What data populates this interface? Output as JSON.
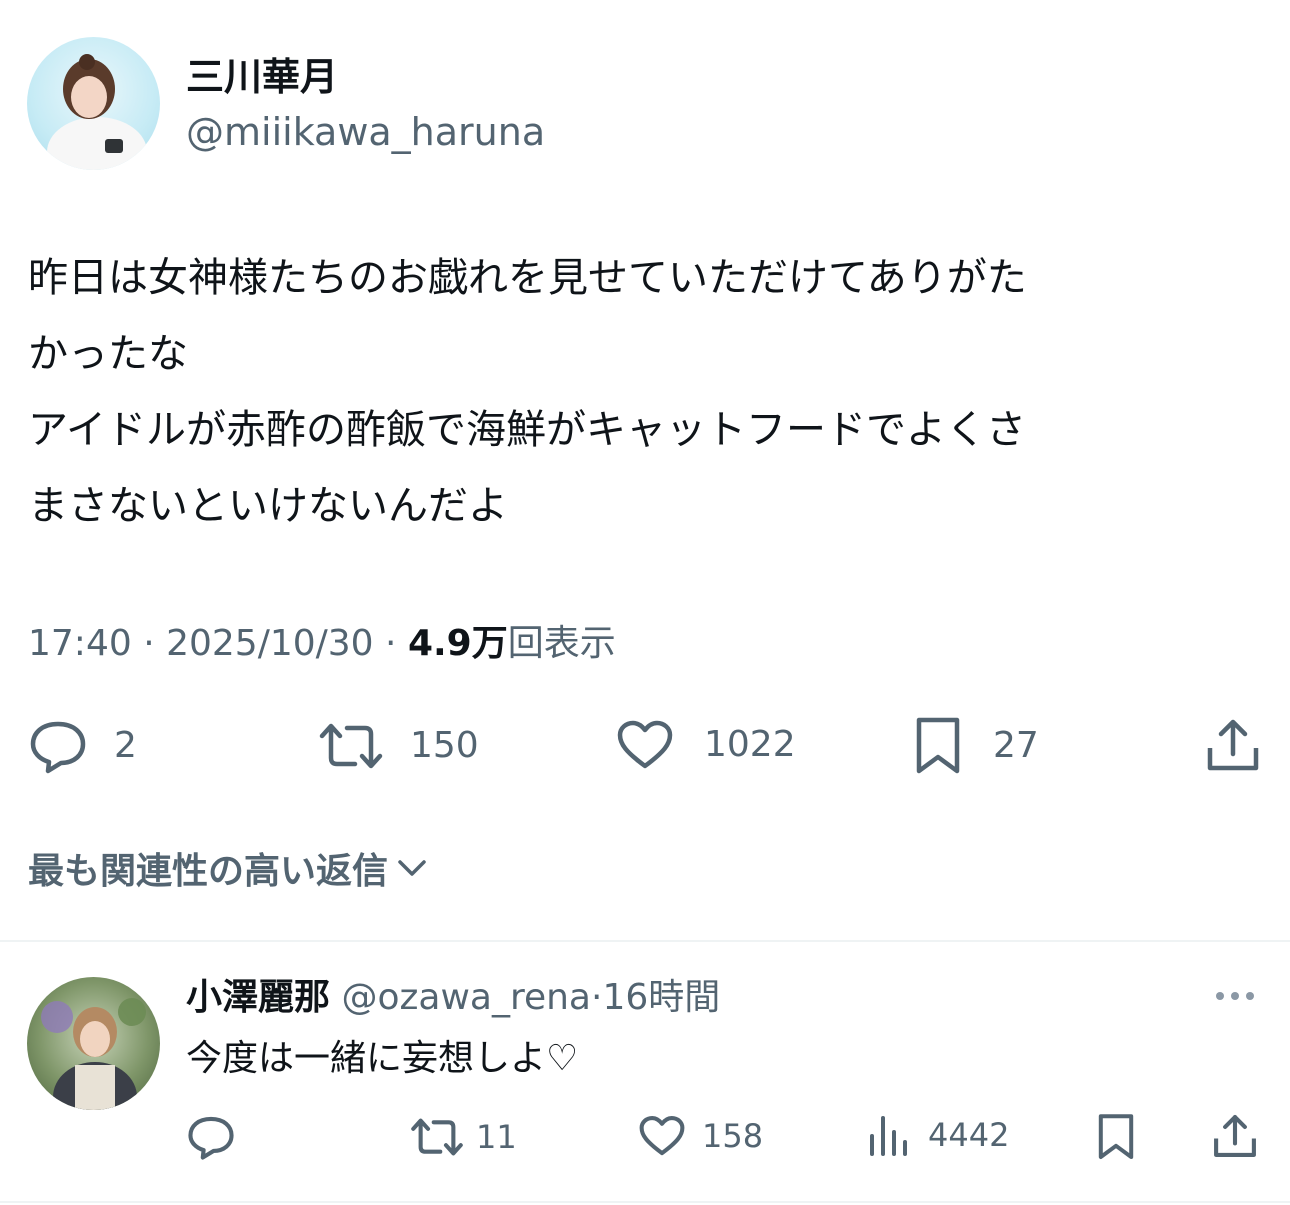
{
  "tweet": {
    "author_name": "三川華月",
    "author_handle": "@miiikawa_haruna",
    "text": "昨日は女神様たちのお戯れを見せていただけてありがた\nかったな\nアイドルが赤酢の酢飯で海鮮がキャットフードでよくさ\nまさないといけないんだよ",
    "time": "17:40",
    "date": "2025/10/30",
    "separator": " · ",
    "views_count": "4.9万",
    "views_label": "回表示",
    "actions": {
      "replies": "2",
      "retweets": "150",
      "likes": "1022",
      "bookmarks": "27"
    }
  },
  "replies_sort_label": "最も関連性の高い返信",
  "reply": {
    "name": "小澤麗那",
    "handle": "@ozawa_rena",
    "separator": "·",
    "time": "16時間",
    "text": "今度は一緒に妄想しよ♡",
    "actions": {
      "retweets": "11",
      "likes": "158",
      "views": "4442"
    }
  },
  "colors": {
    "text": "#0f1419",
    "muted": "#536471",
    "divider": "#eff3f4"
  },
  "icons": {
    "reply": "reply-icon",
    "retweet": "retweet-icon",
    "like": "heart-icon",
    "bookmark": "bookmark-icon",
    "share": "share-icon",
    "views": "views-icon",
    "more": "more-icon",
    "chevron": "chevron-down-icon"
  }
}
